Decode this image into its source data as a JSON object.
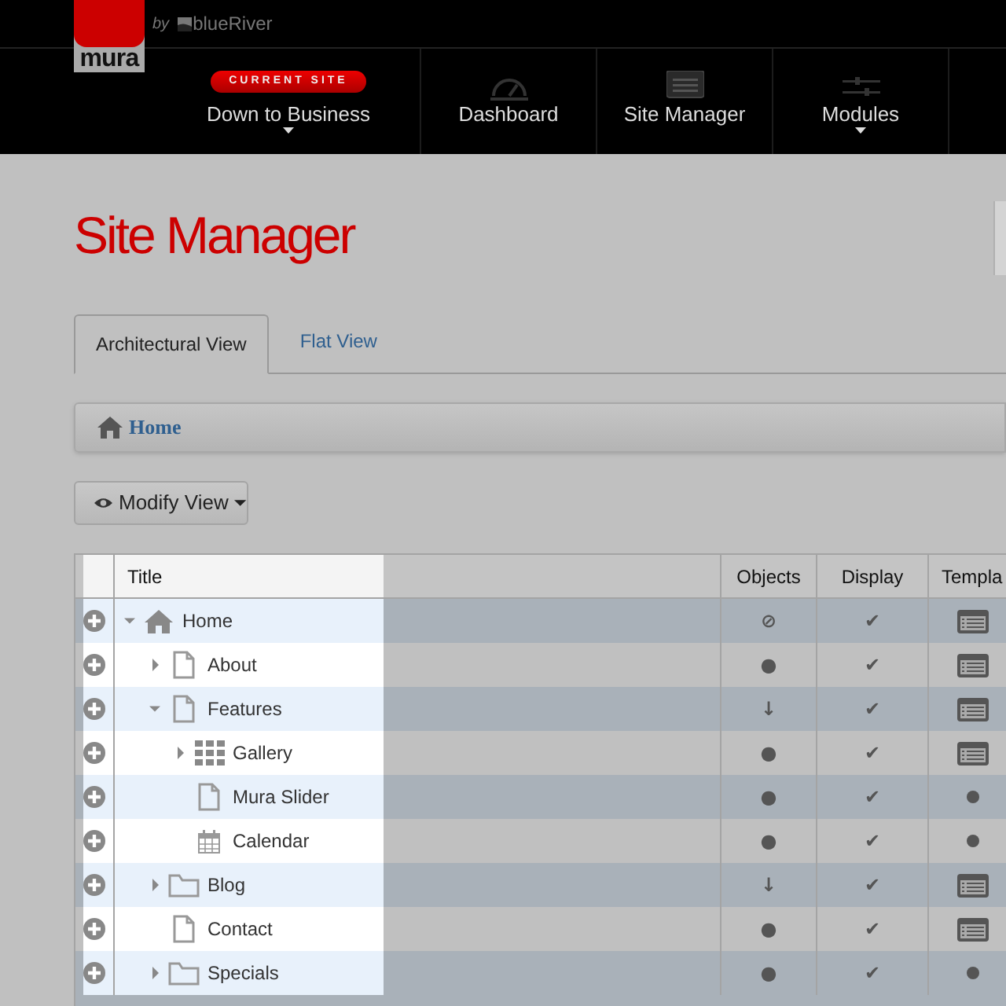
{
  "header": {
    "logo": "mura",
    "by": "by",
    "vendor": "blueRiver"
  },
  "nav": [
    {
      "kind": "site",
      "badge": "CURRENT SITE",
      "label": "Down to Business",
      "dropdown": true
    },
    {
      "kind": "dashboard",
      "label": "Dashboard",
      "dropdown": false
    },
    {
      "kind": "site-manager",
      "label": "Site Manager",
      "dropdown": false
    },
    {
      "kind": "modules",
      "label": "Modules",
      "dropdown": true
    }
  ],
  "page_title": "Site Manager",
  "tabs": [
    {
      "label": "Architectural View",
      "selected": true
    },
    {
      "label": "Flat View",
      "selected": false
    }
  ],
  "breadcrumb": "Home",
  "modify_view": "Modify View",
  "table": {
    "columns": [
      "Title",
      "Objects",
      "Display",
      "Templa"
    ],
    "rows": [
      {
        "title": "Home",
        "kind": "home",
        "expanded": true,
        "objects": "⊘",
        "display": "✔",
        "template_set": true,
        "children": [
          {
            "title": "About",
            "kind": "page",
            "expanded": false,
            "objects": "●",
            "display": "✔",
            "template_set": true
          },
          {
            "title": "Features",
            "kind": "page",
            "expanded": true,
            "objects": "↓",
            "display": "✔",
            "template_set": true,
            "children": [
              {
                "title": "Gallery",
                "kind": "gallery",
                "expanded": false,
                "objects": "●",
                "display": "✔",
                "template_set": true
              },
              {
                "title": "Mura Slider",
                "kind": "page",
                "objects": "●",
                "display": "✔",
                "template_set": false
              },
              {
                "title": "Calendar",
                "kind": "calendar",
                "objects": "●",
                "display": "✔",
                "template_set": false
              }
            ]
          },
          {
            "title": "Blog",
            "kind": "folder",
            "expanded": false,
            "objects": "↓",
            "display": "✔",
            "template_set": true
          },
          {
            "title": "Contact",
            "kind": "page",
            "objects": "●",
            "display": "✔",
            "template_set": true
          },
          {
            "title": "Specials",
            "kind": "folder",
            "expanded": false,
            "objects": "●",
            "display": "✔",
            "template_set": false
          }
        ]
      }
    ]
  }
}
